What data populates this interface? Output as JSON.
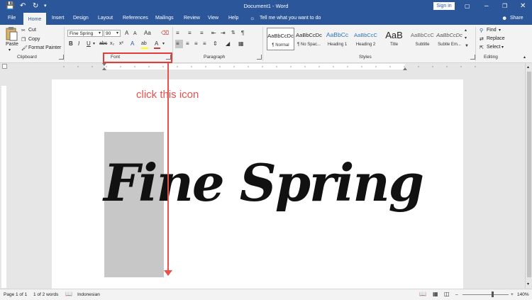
{
  "window": {
    "title": "Document1 - Word",
    "sign_in": "Sign in",
    "share": "Share"
  },
  "tabs": [
    "File",
    "Home",
    "Insert",
    "Design",
    "Layout",
    "References",
    "Mailings",
    "Review",
    "View",
    "Help"
  ],
  "tell_me": "Tell me what you want to do",
  "clipboard": {
    "paste": "Paste",
    "cut": "Cut",
    "copy": "Copy",
    "format_painter": "Format Painter",
    "label": "Clipboard"
  },
  "font": {
    "name": "Fine Spring",
    "size": "90",
    "label": "Font",
    "bold": "B",
    "italic": "I",
    "underline": "U",
    "grow": "A",
    "shrink": "A",
    "case": "Aa",
    "strike": "abc",
    "subscript": "x₂",
    "superscript": "x²",
    "font_color": "A",
    "highlight": "ab"
  },
  "paragraph": {
    "label": "Paragraph"
  },
  "styles": {
    "label": "Styles",
    "items": [
      {
        "preview": "AaBbCcDc",
        "name": "¶ Normal"
      },
      {
        "preview": "AaBbCcDc",
        "name": "¶ No Spac..."
      },
      {
        "preview": "AaBbCc",
        "name": "Heading 1"
      },
      {
        "preview": "AaBbCcC",
        "name": "Heading 2"
      },
      {
        "preview": "AaB",
        "name": "Title"
      },
      {
        "preview": "AaBbCcC",
        "name": "Subtitle"
      },
      {
        "preview": "AaBbCcDc",
        "name": "Subtle Em..."
      }
    ]
  },
  "editing": {
    "find": "Find",
    "replace": "Replace",
    "select": "Select",
    "label": "Editing"
  },
  "document": {
    "text": "Fine Spring"
  },
  "annotation": "click this icon",
  "status": {
    "page": "Page 1 of 1",
    "words": "1 of 2 words",
    "language": "Indonesian",
    "zoom": "140%"
  },
  "colors": {
    "brand": "#2b579a",
    "annotation": "#e8514d",
    "font_color_bar": "#d13438",
    "highlight_bar": "#ffff00"
  }
}
